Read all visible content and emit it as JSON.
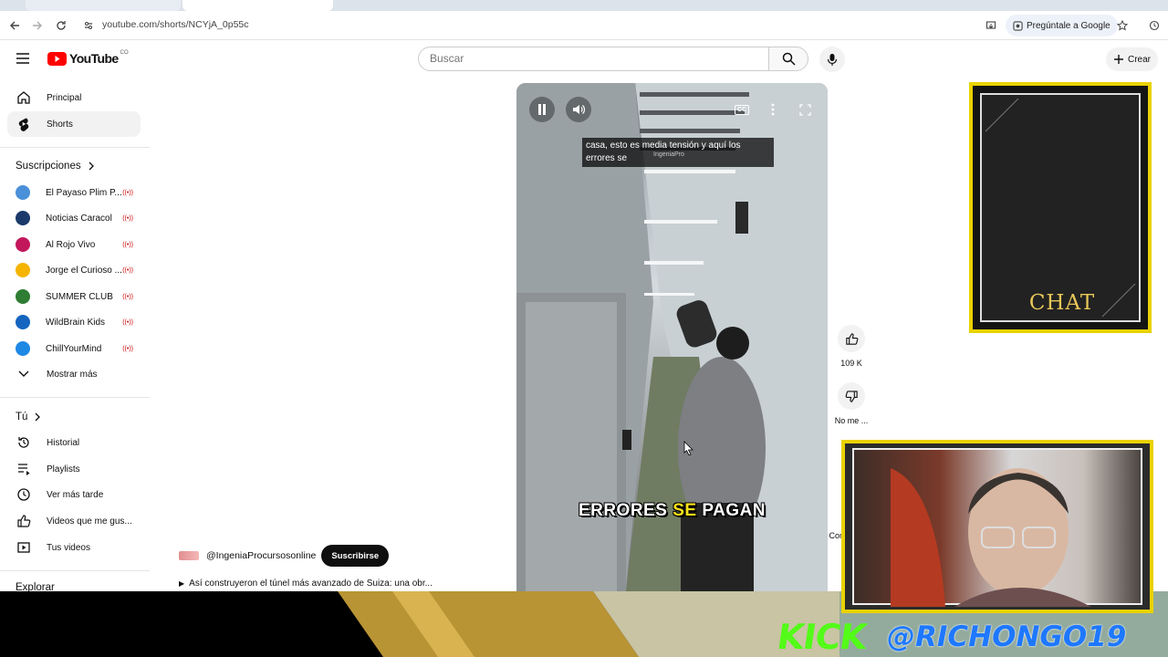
{
  "browser": {
    "url": "youtube.com/shorts/NCYjA_0p55c",
    "ask_google_label": "Pregúntale a Google"
  },
  "header": {
    "logo_text": "YouTube",
    "country_code": "CO",
    "search_placeholder": "Buscar",
    "create_label": "Crear"
  },
  "sidebar": {
    "main": [
      {
        "label": "Principal",
        "icon": "home-icon"
      },
      {
        "label": "Shorts",
        "icon": "shorts-icon"
      }
    ],
    "subscriptions_header": "Suscripciones",
    "subscriptions": [
      {
        "label": "El Payaso Plim P...",
        "color": "#4a90d9"
      },
      {
        "label": "Noticias Caracol",
        "color": "#1b3a6b"
      },
      {
        "label": "Al Rojo Vivo",
        "color": "#c2185b"
      },
      {
        "label": "Jorge el Curioso ...",
        "color": "#f4b400"
      },
      {
        "label": "SUMMER CLUB",
        "color": "#2e7d32"
      },
      {
        "label": "WildBrain Kids",
        "color": "#1565c0"
      },
      {
        "label": "ChillYourMind",
        "color": "#1e88e5"
      }
    ],
    "show_more": "Mostrar más",
    "you_header": "Tú",
    "you_items": [
      {
        "label": "Historial",
        "icon": "history-icon"
      },
      {
        "label": "Playlists",
        "icon": "playlists-icon"
      },
      {
        "label": "Ver más tarde",
        "icon": "watch-later-icon"
      },
      {
        "label": "Videos que me gus...",
        "icon": "liked-icon"
      },
      {
        "label": "Tus videos",
        "icon": "your-videos-icon"
      }
    ],
    "explore_header": "Explorar"
  },
  "player": {
    "caption_top": "casa, esto es media tensión y aquí los errores se",
    "watermark": "IngeniaPro",
    "caption_big_1": "ERRORES",
    "caption_big_2": "SE",
    "caption_big_3": "PAGAN",
    "cc_label": "CC"
  },
  "actions": {
    "likes": "109 K",
    "dislike_label": "No me ...",
    "comments_label": "Com"
  },
  "channel": {
    "handle": "@IngeniaProcursosonline",
    "subscribe_label": "Suscribirse",
    "video_title": "Así construyeron el túnel más avanzado de Suiza: una obr..."
  },
  "overlay": {
    "chat_title": "CHAT",
    "kick_logo": "KICK",
    "kick_handle": "@RICHONGO19"
  }
}
